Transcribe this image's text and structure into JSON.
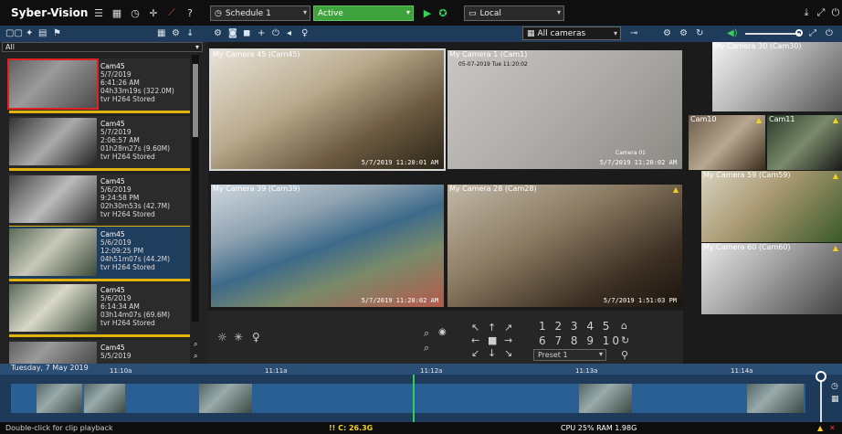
{
  "app": {
    "title": "Syber-Vision"
  },
  "topbar": {
    "schedule": "Schedule 1",
    "status": "Active",
    "location": "Local"
  },
  "toolbar2": {
    "cameras_filter": "All cameras"
  },
  "left": {
    "filter": "All",
    "clips": [
      {
        "name": "Cam45",
        "date": "5/7/2019",
        "time": "6:41:26 AM",
        "dur": "04h33m19s (322.0M)",
        "codec": "tvr H264 Stored"
      },
      {
        "name": "Cam45",
        "date": "5/7/2019",
        "time": "2:06:57 AM",
        "dur": "01h28m27s (9.60M)",
        "codec": "tvr H264 Stored"
      },
      {
        "name": "Cam45",
        "date": "5/6/2019",
        "time": "9:24:58 PM",
        "dur": "02h30m53s (42.7M)",
        "codec": "tvr H264 Stored"
      },
      {
        "name": "Cam45",
        "date": "5/6/2019",
        "time": "12:09:25 PM",
        "dur": "04h51m07s (44.2M)",
        "codec": "tvr H264 Stored"
      },
      {
        "name": "Cam45",
        "date": "5/6/2019",
        "time": "6:14:34 AM",
        "dur": "03h14m07s (69.6M)",
        "codec": "tvr H264 Stored"
      },
      {
        "name": "Cam45",
        "date": "5/5/2019",
        "time": "",
        "dur": "",
        "codec": ""
      }
    ]
  },
  "cameras": [
    {
      "title": "My Camera 45 (Cam45)",
      "ts": "5/7/2019 11:20:01 AM"
    },
    {
      "title": "My Camera 1 (Cam1)",
      "ts": "5/7/2019 11:20:02 AM",
      "overlay": "05-07-2019 Tue 11:20:02",
      "label": "Camera 01"
    },
    {
      "title": "My Camera 30 (Cam30)"
    },
    {
      "title": "Cam10"
    },
    {
      "title": "Cam11"
    },
    {
      "title": "My Camera 39 (Cam39)",
      "ts": "5/7/2019 11:20:02 AM"
    },
    {
      "title": "My Camera 28 (Cam28)",
      "ts": "5/7/2019 1:51:03 PM"
    },
    {
      "title": "My Camera 59 (Cam59)"
    },
    {
      "title": "My Camera 60 (Cam60)"
    }
  ],
  "ptz": {
    "numbers_row1": "1 2 3 4 5",
    "numbers_row2": "6 7 8 9 10",
    "preset": "Preset 1"
  },
  "timeline": {
    "date": "Tuesday, 7 May 2019",
    "ticks": [
      "11:10a",
      "11:11a",
      "11:12a",
      "11:13a",
      "11:14a"
    ]
  },
  "status": {
    "hint": "Double-click for clip playback",
    "disk": "!! C: 26.3G",
    "perf": "CPU 25% RAM 1.98G"
  }
}
